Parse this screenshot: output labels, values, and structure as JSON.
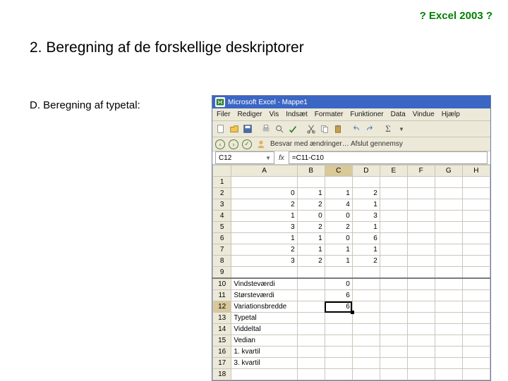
{
  "header_link": "? Excel 2003 ?",
  "title": "2. Beregning af de forskellige deskriptorer",
  "subtitle": "D. Beregning af typetal:",
  "excel": {
    "title": "Microsoft Excel - Mappe1",
    "menus": {
      "filer": "Filer",
      "rediger": "Rediger",
      "vis": "Vis",
      "indsaet": "Indsæt",
      "formater": "Formater",
      "funktioner": "Funktioner",
      "data": "Data",
      "vindue": "Vindue",
      "hjaelp": "Hjælp"
    },
    "task_text": "Besvar med ændringer… Afslut gennemsy",
    "namebox": "C12",
    "formula": "=C11-C10",
    "columns": [
      "A",
      "B",
      "C",
      "D",
      "E",
      "F",
      "G",
      "H"
    ],
    "rows": [
      {
        "n": "1",
        "cells": [
          "",
          "",
          "",
          "",
          "",
          "",
          "",
          ""
        ]
      },
      {
        "n": "2",
        "cells": [
          "0",
          "1",
          "1",
          "2",
          "",
          "",
          "",
          ""
        ]
      },
      {
        "n": "3",
        "cells": [
          "2",
          "2",
          "4",
          "1",
          "",
          "",
          "",
          ""
        ]
      },
      {
        "n": "4",
        "cells": [
          "1",
          "0",
          "0",
          "3",
          "",
          "",
          "",
          ""
        ]
      },
      {
        "n": "5",
        "cells": [
          "3",
          "2",
          "2",
          "1",
          "",
          "",
          "",
          ""
        ]
      },
      {
        "n": "6",
        "cells": [
          "1",
          "1",
          "0",
          "6",
          "",
          "",
          "",
          ""
        ]
      },
      {
        "n": "7",
        "cells": [
          "2",
          "1",
          "1",
          "1",
          "",
          "",
          "",
          ""
        ]
      },
      {
        "n": "8",
        "cells": [
          "3",
          "2",
          "1",
          "2",
          "",
          "",
          "",
          ""
        ]
      },
      {
        "n": "9",
        "cells": [
          "",
          "",
          "",
          "",
          "",
          "",
          "",
          ""
        ]
      },
      {
        "n": "10",
        "cells": [
          "Vindsteværdi",
          "",
          "0",
          "",
          "",
          "",
          "",
          ""
        ]
      },
      {
        "n": "11",
        "cells": [
          "Størsteværdi",
          "",
          "6",
          "",
          "",
          "",
          "",
          ""
        ]
      },
      {
        "n": "12",
        "cells": [
          "Variationsbredde",
          "",
          "6",
          "",
          "",
          "",
          "",
          ""
        ],
        "selected": true
      },
      {
        "n": "13",
        "cells": [
          "Typetal",
          "",
          "",
          "",
          "",
          "",
          "",
          ""
        ]
      },
      {
        "n": "14",
        "cells": [
          "Viddeltal",
          "",
          "",
          "",
          "",
          "",
          "",
          ""
        ]
      },
      {
        "n": "15",
        "cells": [
          "Vedian",
          "",
          "",
          "",
          "",
          "",
          "",
          ""
        ]
      },
      {
        "n": "16",
        "cells": [
          "1. kvartil",
          "",
          "",
          "",
          "",
          "",
          "",
          ""
        ]
      },
      {
        "n": "17",
        "cells": [
          "3. kvartil",
          "",
          "",
          "",
          "",
          "",
          "",
          ""
        ]
      },
      {
        "n": "18",
        "cells": [
          "",
          "",
          "",
          "",
          "",
          "",
          "",
          ""
        ]
      }
    ]
  }
}
